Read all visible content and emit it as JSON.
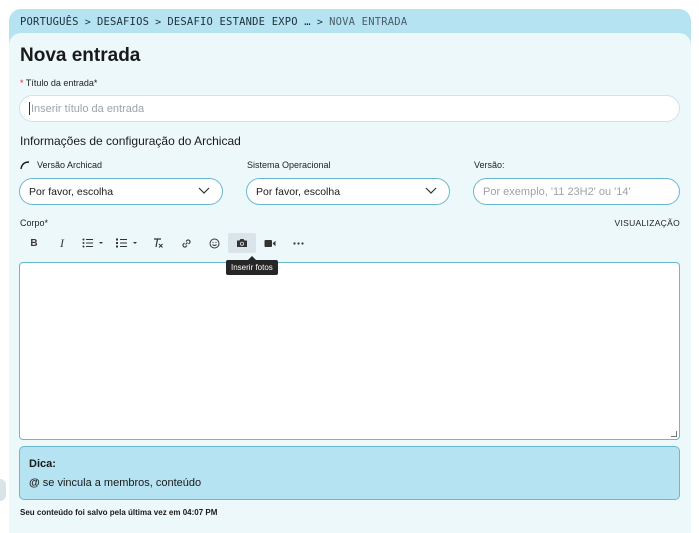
{
  "breadcrumb": {
    "items": [
      "PORTUGUÊS",
      "DESAFIOS",
      "DESAFIO ESTANDE EXPO …"
    ],
    "current": "NOVA ENTRADA"
  },
  "page": {
    "title": "Nova entrada"
  },
  "entry_title": {
    "label": "Título da entrada*",
    "required_mark": "*",
    "placeholder": "Inserir título da entrada"
  },
  "config": {
    "heading": "Informações de configuração do Archicad",
    "archicad_version": {
      "label": "Versão Archicad",
      "value": "Por favor, escolha"
    },
    "os": {
      "label": "Sistema Operacional",
      "value": "Por favor, escolha"
    },
    "version": {
      "label": "Versão:",
      "placeholder": "Por exemplo, '11 23H2' ou '14'"
    }
  },
  "body": {
    "label": "Corpo*",
    "preview": "VISUALIZAÇÃO",
    "toolbar": [
      {
        "name": "bold-icon",
        "glyph": "B"
      },
      {
        "name": "italic-icon",
        "glyph": "I"
      },
      {
        "name": "bullet-list-icon",
        "glyph": "☰"
      },
      {
        "name": "numbered-list-icon",
        "glyph": "☷"
      },
      {
        "name": "clear-format-icon",
        "glyph": "T"
      },
      {
        "name": "link-icon",
        "glyph": "🔗"
      },
      {
        "name": "emoji-icon",
        "glyph": "☺"
      },
      {
        "name": "camera-icon",
        "glyph": "📷"
      },
      {
        "name": "video-icon",
        "glyph": "■"
      },
      {
        "name": "more-icon",
        "glyph": "•••"
      }
    ],
    "tooltip": "Inserir fotos"
  },
  "tip": {
    "heading": "Dica:",
    "symbol": "@",
    "text": " se vincula a membros, conteúdo"
  },
  "status": {
    "saved": "Seu conteúdo foi salvo pela última vez em 04:07 PM"
  },
  "colors": {
    "frame": "#b5e3f1",
    "panel": "#edf8fb",
    "border": "#6ab8cf",
    "required": "#dd3333"
  }
}
